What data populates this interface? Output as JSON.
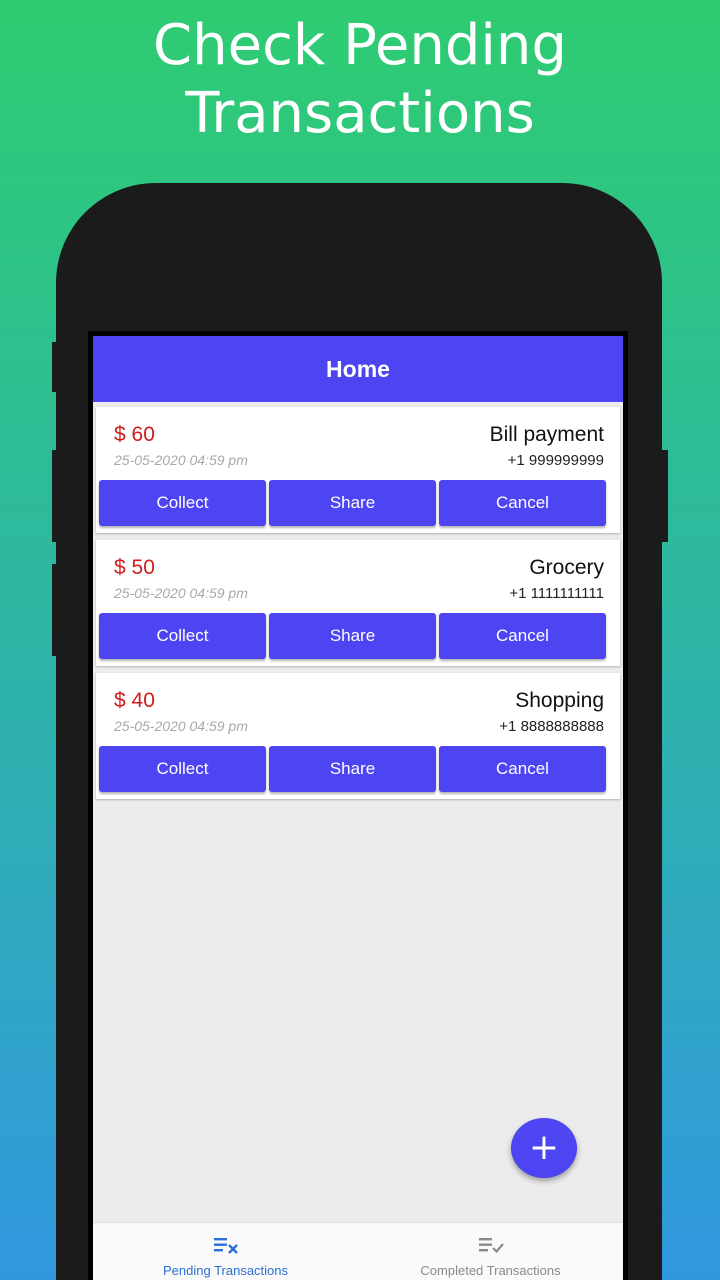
{
  "promo": {
    "headline_line1": "Check Pending",
    "headline_line2": "Transactions"
  },
  "app": {
    "title": "Home"
  },
  "colors": {
    "primary": "#4d44f2",
    "amount": "#d01c1c",
    "nav_active": "#2b6fd6",
    "nav_inactive": "#8a8a8a"
  },
  "transactions": [
    {
      "amount": "$ 60",
      "datetime": "25-05-2020 04:59 pm",
      "title": "Bill payment",
      "phone": "+1 999999999",
      "collect_label": "Collect",
      "share_label": "Share",
      "cancel_label": "Cancel"
    },
    {
      "amount": "$ 50",
      "datetime": "25-05-2020 04:59 pm",
      "title": "Grocery",
      "phone": "+1 1111111111",
      "collect_label": "Collect",
      "share_label": "Share",
      "cancel_label": "Cancel"
    },
    {
      "amount": "$ 40",
      "datetime": "25-05-2020 04:59 pm",
      "title": "Shopping",
      "phone": "+1 8888888888",
      "collect_label": "Collect",
      "share_label": "Share",
      "cancel_label": "Cancel"
    }
  ],
  "fab": {
    "icon": "plus-icon",
    "glyph": "+"
  },
  "bottom_nav": {
    "items": [
      {
        "label": "Pending Transactions",
        "icon": "list-x-icon",
        "active": true
      },
      {
        "label": "Completed Transactions",
        "icon": "list-check-icon",
        "active": false
      }
    ]
  }
}
